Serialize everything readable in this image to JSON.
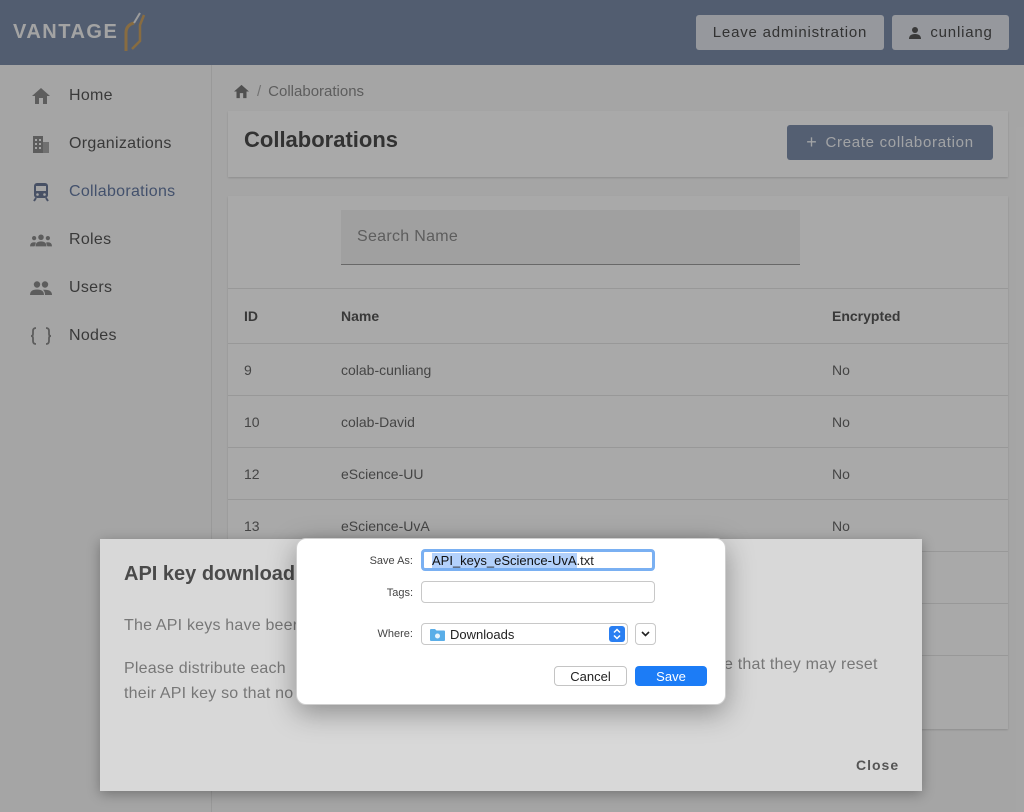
{
  "header": {
    "logo_text": "VANTAGE",
    "leave_label": "Leave administration",
    "user_label": "cunliang"
  },
  "sidebar": {
    "items": [
      {
        "label": "Home",
        "icon": "home-icon"
      },
      {
        "label": "Organizations",
        "icon": "building-icon"
      },
      {
        "label": "Collaborations",
        "icon": "train-icon",
        "active": true
      },
      {
        "label": "Roles",
        "icon": "group-icon"
      },
      {
        "label": "Users",
        "icon": "users-icon"
      },
      {
        "label": "Nodes",
        "icon": "braces-icon"
      }
    ]
  },
  "breadcrumb": {
    "current": "Collaborations"
  },
  "page": {
    "title": "Collaborations",
    "create_label": "Create collaboration"
  },
  "search": {
    "placeholder": "Search Name"
  },
  "table": {
    "headers": {
      "id": "ID",
      "name": "Name",
      "encrypted": "Encrypted"
    },
    "rows": [
      {
        "id": "9",
        "name": "colab-cunliang",
        "encrypted": "No"
      },
      {
        "id": "10",
        "name": "colab-David",
        "encrypted": "No"
      },
      {
        "id": "12",
        "name": "eScience-UU",
        "encrypted": "No"
      },
      {
        "id": "13",
        "name": "eScience-UvA",
        "encrypted": "No"
      }
    ]
  },
  "api_dialog": {
    "title": "API key download",
    "p1": "The API keys have beer",
    "p2_line1": "Please distribute each",
    "p2_line2": "their API key so that no",
    "p2_right": "e that they may reset",
    "close_label": "Close"
  },
  "save_sheet": {
    "save_as_label": "Save As:",
    "filename_selected": "API_keys_eScience-UvA",
    "filename_ext": ".txt",
    "tags_label": "Tags:",
    "where_label": "Where:",
    "where_value": "Downloads",
    "cancel_label": "Cancel",
    "save_label": "Save"
  },
  "colors": {
    "header_bg": "#7a8aa6",
    "accent": "#6478a0",
    "save_button": "#1c7cf6"
  }
}
